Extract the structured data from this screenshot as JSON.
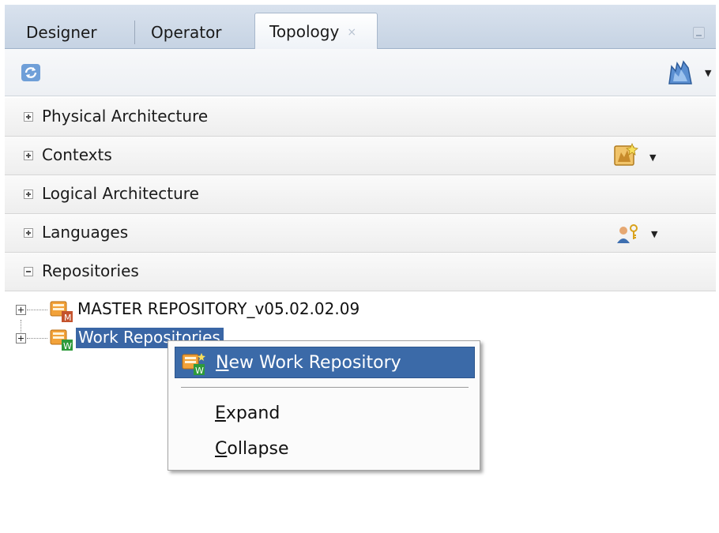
{
  "tabs": [
    {
      "label": "Designer",
      "active": false
    },
    {
      "label": "Operator",
      "active": false
    },
    {
      "label": "Topology",
      "active": true
    }
  ],
  "tab_close_glyph": "×",
  "toolbar": {
    "left_icon": "refresh-icon",
    "right_icon": "connect-navigator-icon"
  },
  "sections": [
    {
      "label": "Physical Architecture",
      "expanded": false
    },
    {
      "label": "Contexts",
      "expanded": false
    },
    {
      "label": "Logical Architecture",
      "expanded": false
    },
    {
      "label": "Languages",
      "expanded": false
    },
    {
      "label": "Repositories",
      "expanded": true
    }
  ],
  "tree": [
    {
      "label": "MASTER REPOSITORY_v05.02.02.09",
      "icon": "master-repository-icon",
      "selected": false
    },
    {
      "label": "Work Repositories",
      "icon": "work-repository-icon",
      "selected": true
    }
  ],
  "context_menu": {
    "items": [
      {
        "pre": "",
        "mnemonic": "N",
        "post": "ew Work Repository",
        "highlighted": true
      },
      {
        "pre": "",
        "mnemonic": "E",
        "post": "xpand",
        "highlighted": false
      },
      {
        "pre": "",
        "mnemonic": "C",
        "post": "ollapse",
        "highlighted": false
      }
    ]
  },
  "colors": {
    "selection": "#3a66a5",
    "menu_highlight": "#3b6aa8",
    "tab_strip": "#c6d3e3"
  }
}
